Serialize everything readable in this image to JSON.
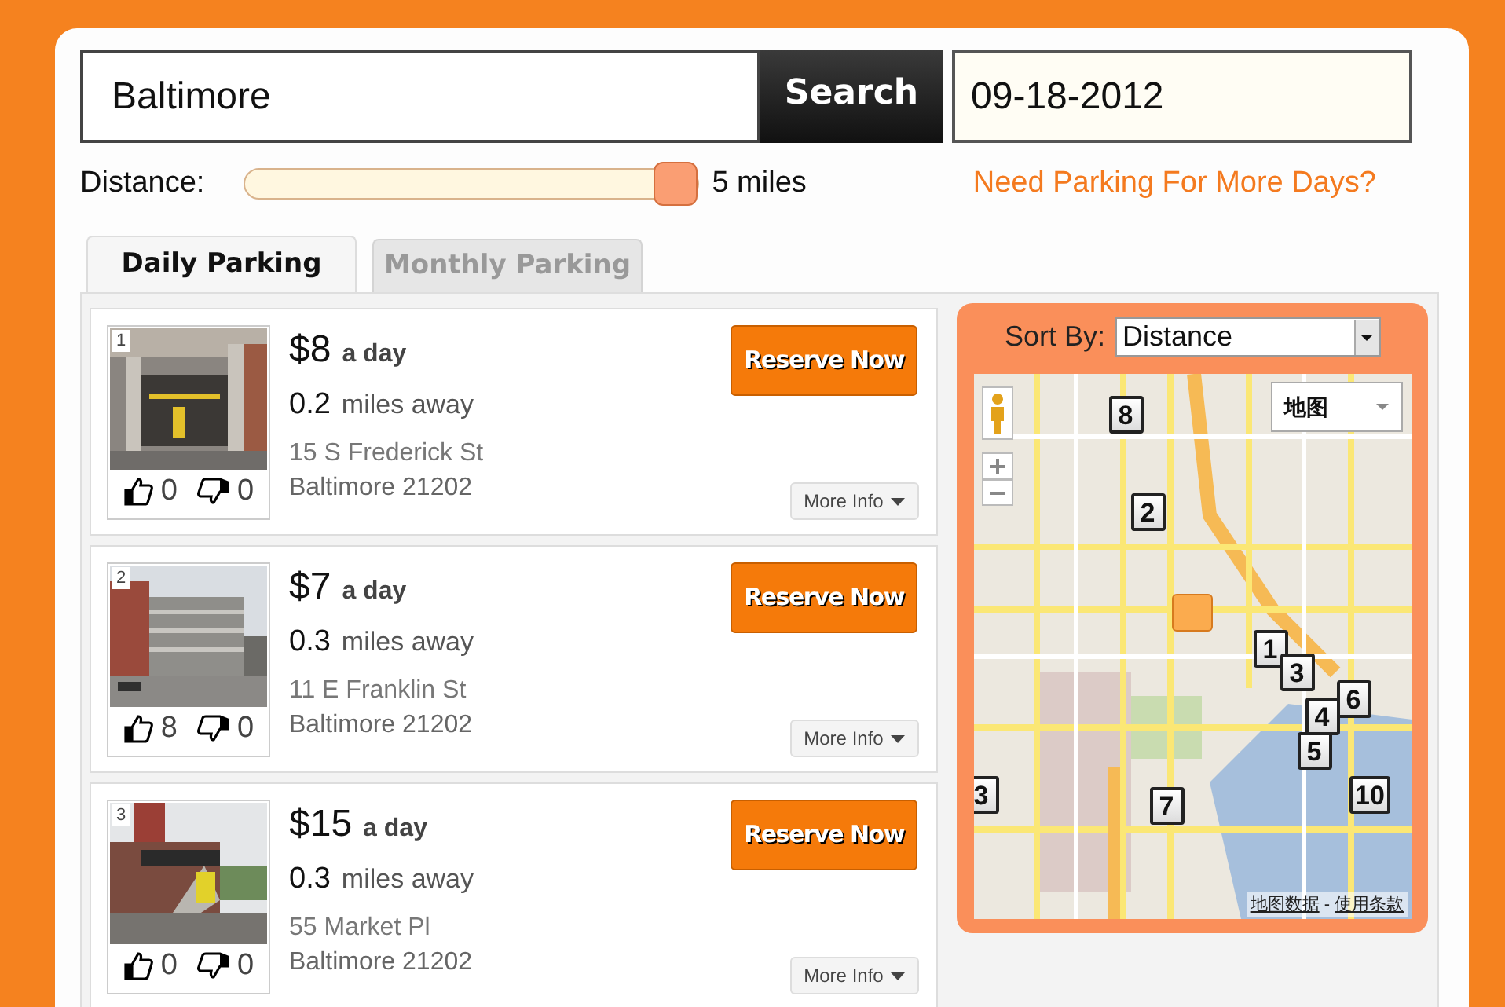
{
  "search": {
    "value": "Baltimore",
    "button": "Search",
    "date": "09-18-2012"
  },
  "distance": {
    "label": "Distance:",
    "level": 1,
    "reading": "5 miles",
    "more_days_link": "Need Parking For More Days?"
  },
  "tabs": [
    {
      "label": "Daily Parking",
      "selected": true
    },
    {
      "label": "Monthly Parking",
      "selected": false
    }
  ],
  "listings": [
    {
      "number": "1",
      "price": "$8",
      "unit": "a day",
      "distance": "0.2",
      "distance_unit": "miles away",
      "address": "15 S Frederick St",
      "city": "Baltimore 21202",
      "likes": "0",
      "dislikes": "0",
      "reserve": "Reserve Now",
      "more_info": "More Info"
    },
    {
      "number": "2",
      "price": "$7",
      "unit": "a day",
      "distance": "0.3",
      "distance_unit": "miles away",
      "address": "11 E Franklin St",
      "city": "Baltimore 21202",
      "likes": "8",
      "dislikes": "0",
      "reserve": "Reserve Now",
      "more_info": "More Info"
    },
    {
      "number": "3",
      "price": "$15",
      "unit": "a day",
      "distance": "0.3",
      "distance_unit": "miles away",
      "address": "55 Market Pl",
      "city": "Baltimore 21202",
      "likes": "0",
      "dislikes": "0",
      "reserve": "Reserve Now",
      "more_info": "More Info"
    }
  ],
  "map_panel": {
    "sort_label": "Sort By:",
    "sort_value": "Distance",
    "map_type": "地图",
    "markers": [
      {
        "label": "8"
      },
      {
        "label": "2"
      },
      {
        "label": "1"
      },
      {
        "label": "3"
      },
      {
        "label": "6"
      },
      {
        "label": "4"
      },
      {
        "label": "5"
      },
      {
        "label": "3"
      },
      {
        "label": "7"
      },
      {
        "label": "10"
      }
    ],
    "map_data_link": "地图数据",
    "separator": "-",
    "terms_link": "使用条款"
  }
}
